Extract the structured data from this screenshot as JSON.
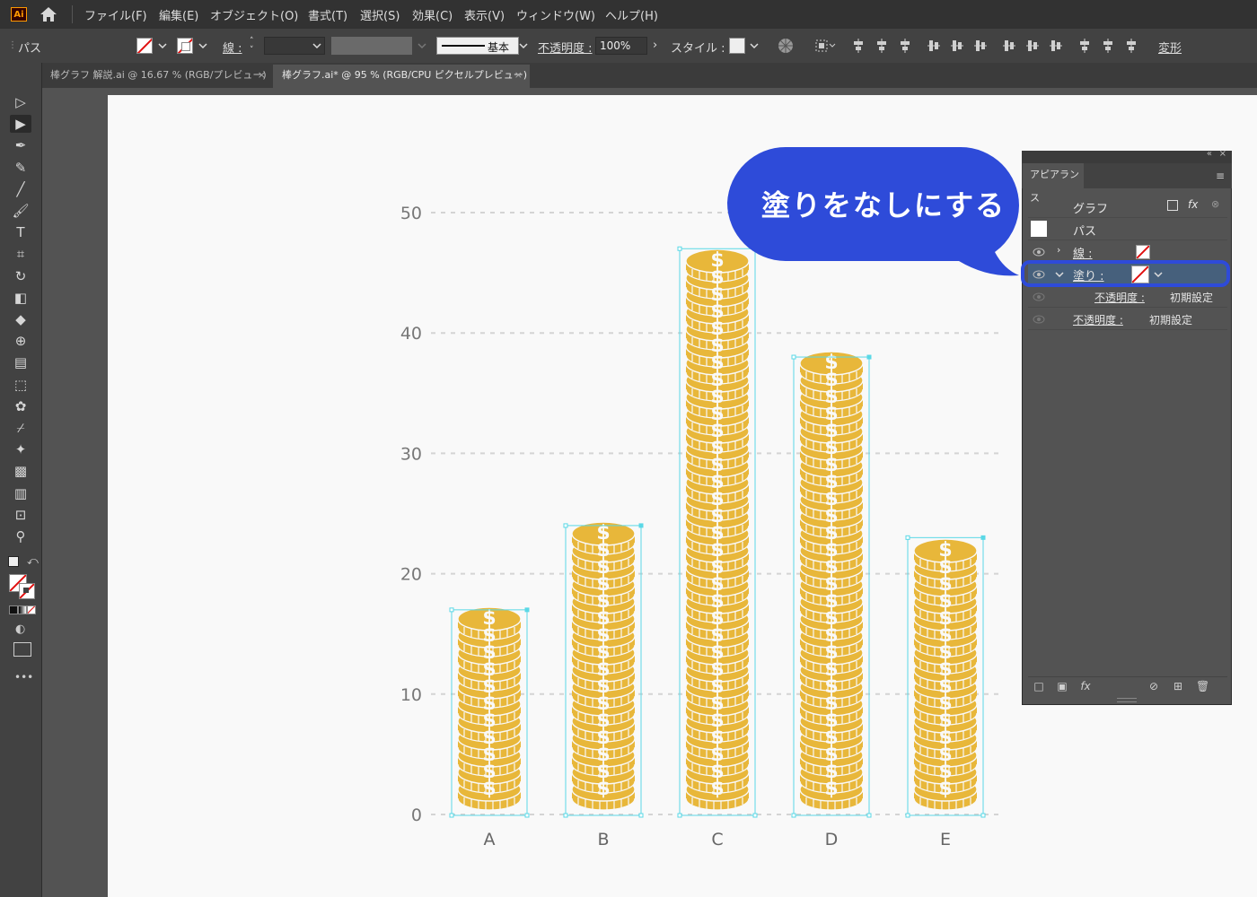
{
  "menu": {
    "items": [
      "ファイル(F)",
      "編集(E)",
      "オブジェクト(O)",
      "書式(T)",
      "選択(S)",
      "効果(C)",
      "表示(V)",
      "ウィンドウ(W)",
      "ヘルプ(H)"
    ],
    "logo": "Ai"
  },
  "control_bar": {
    "object_type": "パス",
    "stroke_label": "線 :",
    "stroke_style": "基本",
    "opacity_label": "不透明度 :",
    "opacity_value": "100%",
    "style_label": "スタイル :",
    "transform_label": "変形"
  },
  "tabs": [
    {
      "title": "棒グラフ 解説.ai @ 16.67 % (RGB/プレビュー)",
      "close": "×",
      "active": false
    },
    {
      "title": "棒グラフ.ai* @ 95 % (RGB/CPU ピクセルプレビュー)",
      "close": "×",
      "active": true
    }
  ],
  "toolbar": {
    "icons": [
      "selection-tool-icon",
      "direct-selection-tool-icon",
      "pen-tool-icon",
      "curvature-tool-icon",
      "line-tool-icon",
      "paintbrush-tool-icon",
      "type-tool-icon",
      "area-type-icon",
      "rotate-tool-icon",
      "width-tool-icon",
      "eraser-tool-icon",
      "shape-builder-icon",
      "gradient-tool-icon",
      "blend-tool-icon",
      "symbol-sprayer-icon",
      "eyedropper-tool-icon",
      "puppet-warp-icon",
      "live-paint-icon",
      "graph-tool-icon",
      "artboard-tool-icon",
      "zoom-tool-icon"
    ],
    "more": "•••"
  },
  "callout": {
    "text": "塗りをなしにする",
    "color": "#2e4bd9"
  },
  "appearance_panel": {
    "tab": "アピアランス",
    "object_label": "グラフ",
    "path_label": "パス",
    "stroke_label": "線 :",
    "fill_label": "塗り :",
    "fill_opacity_label": "不透明度 :",
    "fill_opacity_value": "初期設定",
    "opacity_label": "不透明度 :",
    "opacity_value": "初期設定",
    "fx": "fx"
  },
  "chart_data": {
    "type": "bar",
    "categories": [
      "A",
      "B",
      "C",
      "D",
      "E"
    ],
    "values": [
      17,
      24,
      47,
      38,
      23
    ],
    "ylim": [
      0,
      50
    ],
    "yticks": [
      0,
      10,
      20,
      30,
      40,
      50
    ],
    "grid": true,
    "grid_style": "dashed",
    "bar_symbol": "coin-stack",
    "bar_color": "#e8b73a",
    "selection_color": "#5ad8e6"
  }
}
